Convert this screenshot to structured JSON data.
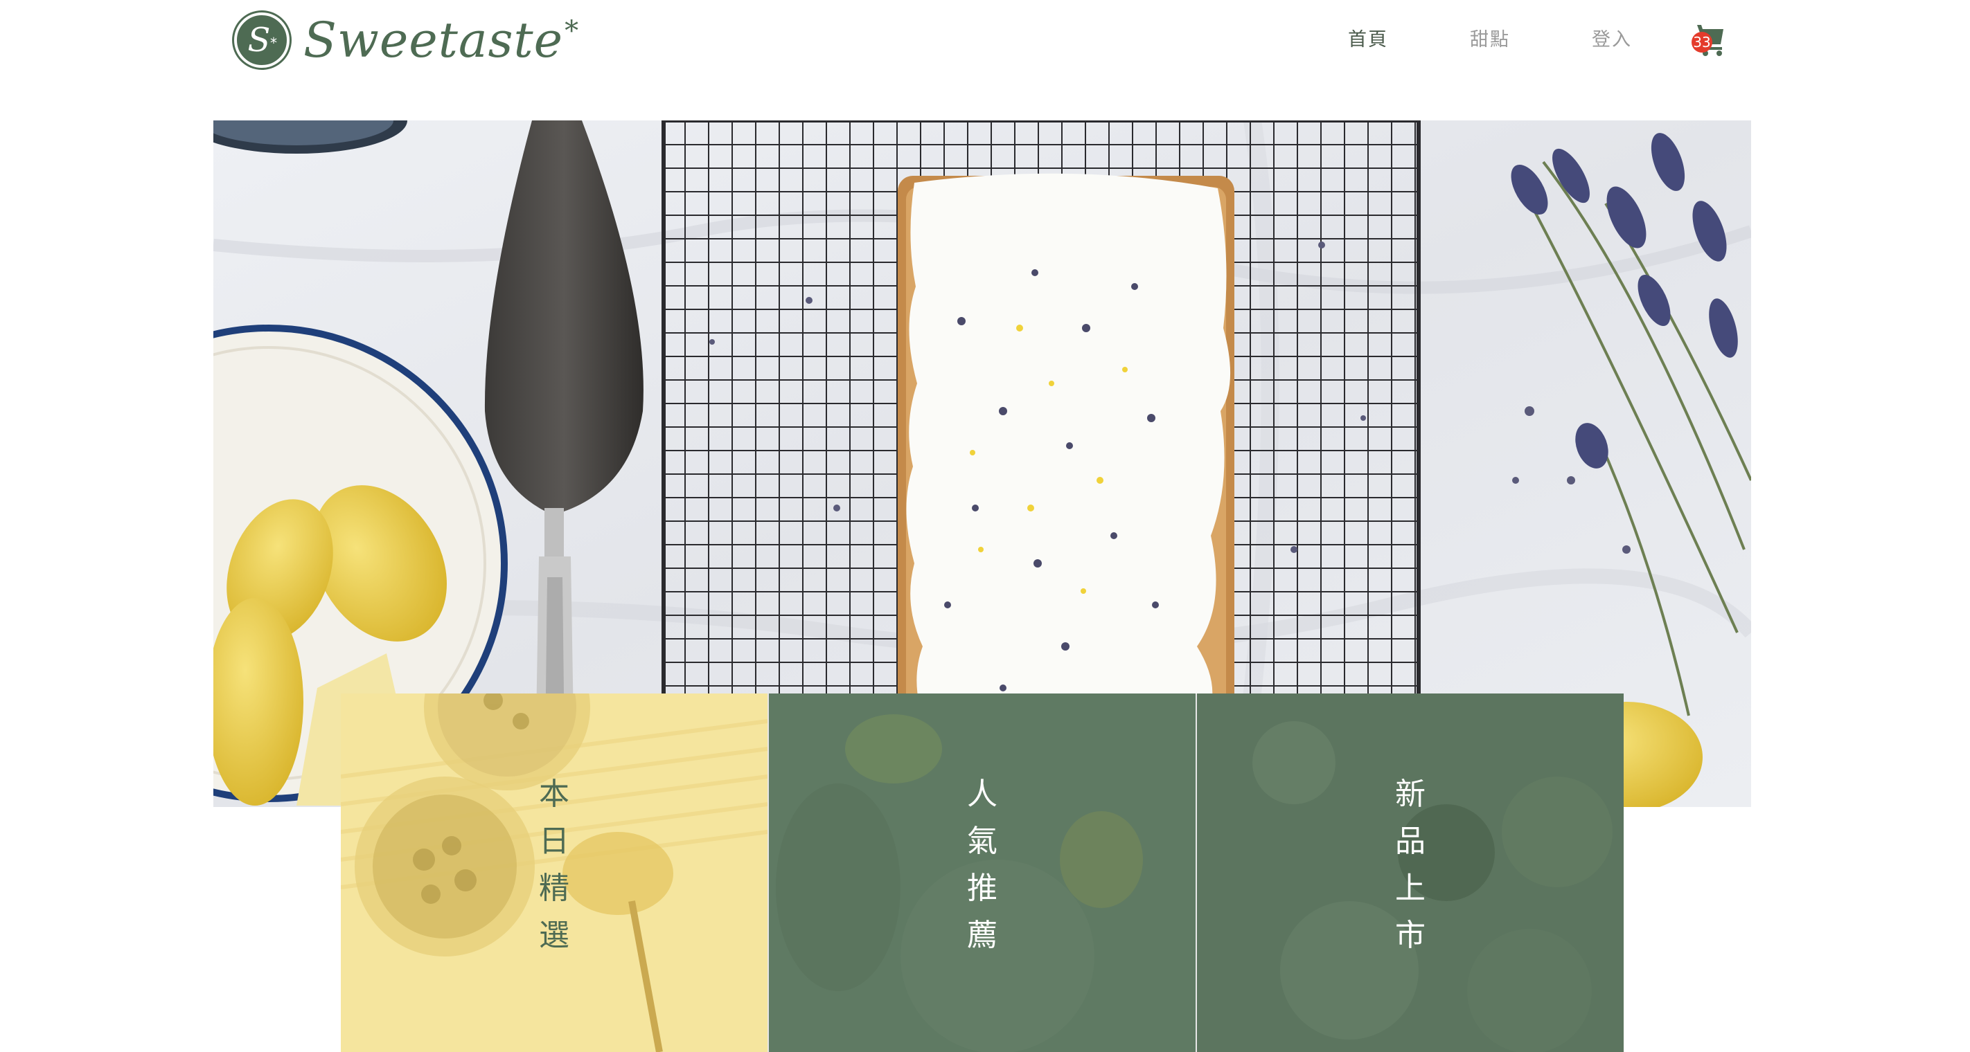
{
  "brand": {
    "name": "Sweetaste",
    "mark": "*",
    "badge_letter": "S",
    "color": "#4e6b53"
  },
  "nav": {
    "items": [
      {
        "label": "首頁",
        "active": true
      },
      {
        "label": "甜點",
        "active": false
      },
      {
        "label": "登入",
        "active": false
      }
    ]
  },
  "cart": {
    "icon": "shopping-cart-icon",
    "count": "33",
    "badge_color": "#e43b2b"
  },
  "hero": {
    "image": "lemon-lavender-pound-cake-on-cooling-rack"
  },
  "categories": [
    {
      "label": "本日精選",
      "overlay_color": "#f6e6a0",
      "text_color": "#4e6b53"
    },
    {
      "label": "人氣推薦",
      "overlay_color": "#5f7a63",
      "text_color": "#ffffff"
    },
    {
      "label": "新品上市",
      "overlay_color": "#5c755f",
      "text_color": "#ffffff"
    }
  ]
}
